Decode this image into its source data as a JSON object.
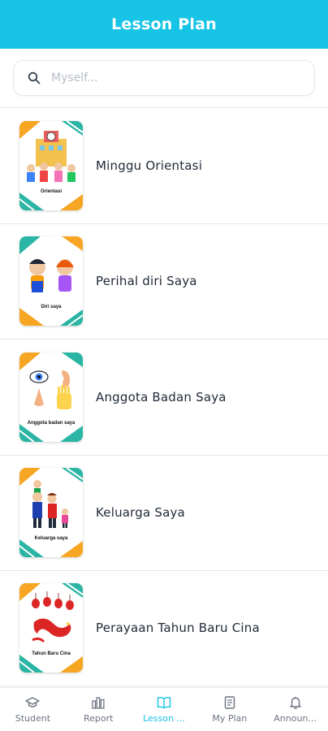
{
  "header": {
    "title": "Lesson Plan"
  },
  "search": {
    "placeholder": "Myself..."
  },
  "colors": {
    "accent": "#17c4e6",
    "thumb_orange": "#f6a623",
    "thumb_teal": "#2bb5a4"
  },
  "lessons": [
    {
      "title": "Minggu Orientasi",
      "thumb_label": "Orientasi",
      "icon": "school-children-icon"
    },
    {
      "title": "Perihal diri Saya",
      "thumb_label": "Diri saya",
      "icon": "boy-girl-icon"
    },
    {
      "title": "Anggota Badan Saya",
      "thumb_label": "Anggota badan saya",
      "icon": "body-parts-icon"
    },
    {
      "title": "Keluarga Saya",
      "thumb_label": "Keluarga saya",
      "icon": "family-icon"
    },
    {
      "title": "Perayaan Tahun Baru Cina",
      "thumb_label": "Tahun Baru Cina",
      "icon": "dragon-lantern-icon"
    }
  ],
  "tabs": [
    {
      "label": "Student",
      "icon": "graduation-cap-icon",
      "active": false
    },
    {
      "label": "Report",
      "icon": "bar-chart-icon",
      "active": false
    },
    {
      "label": "Lesson ...",
      "icon": "open-book-icon",
      "active": true
    },
    {
      "label": "My Plan",
      "icon": "document-icon",
      "active": false
    },
    {
      "label": "Announ...",
      "icon": "bell-icon",
      "active": false
    }
  ]
}
